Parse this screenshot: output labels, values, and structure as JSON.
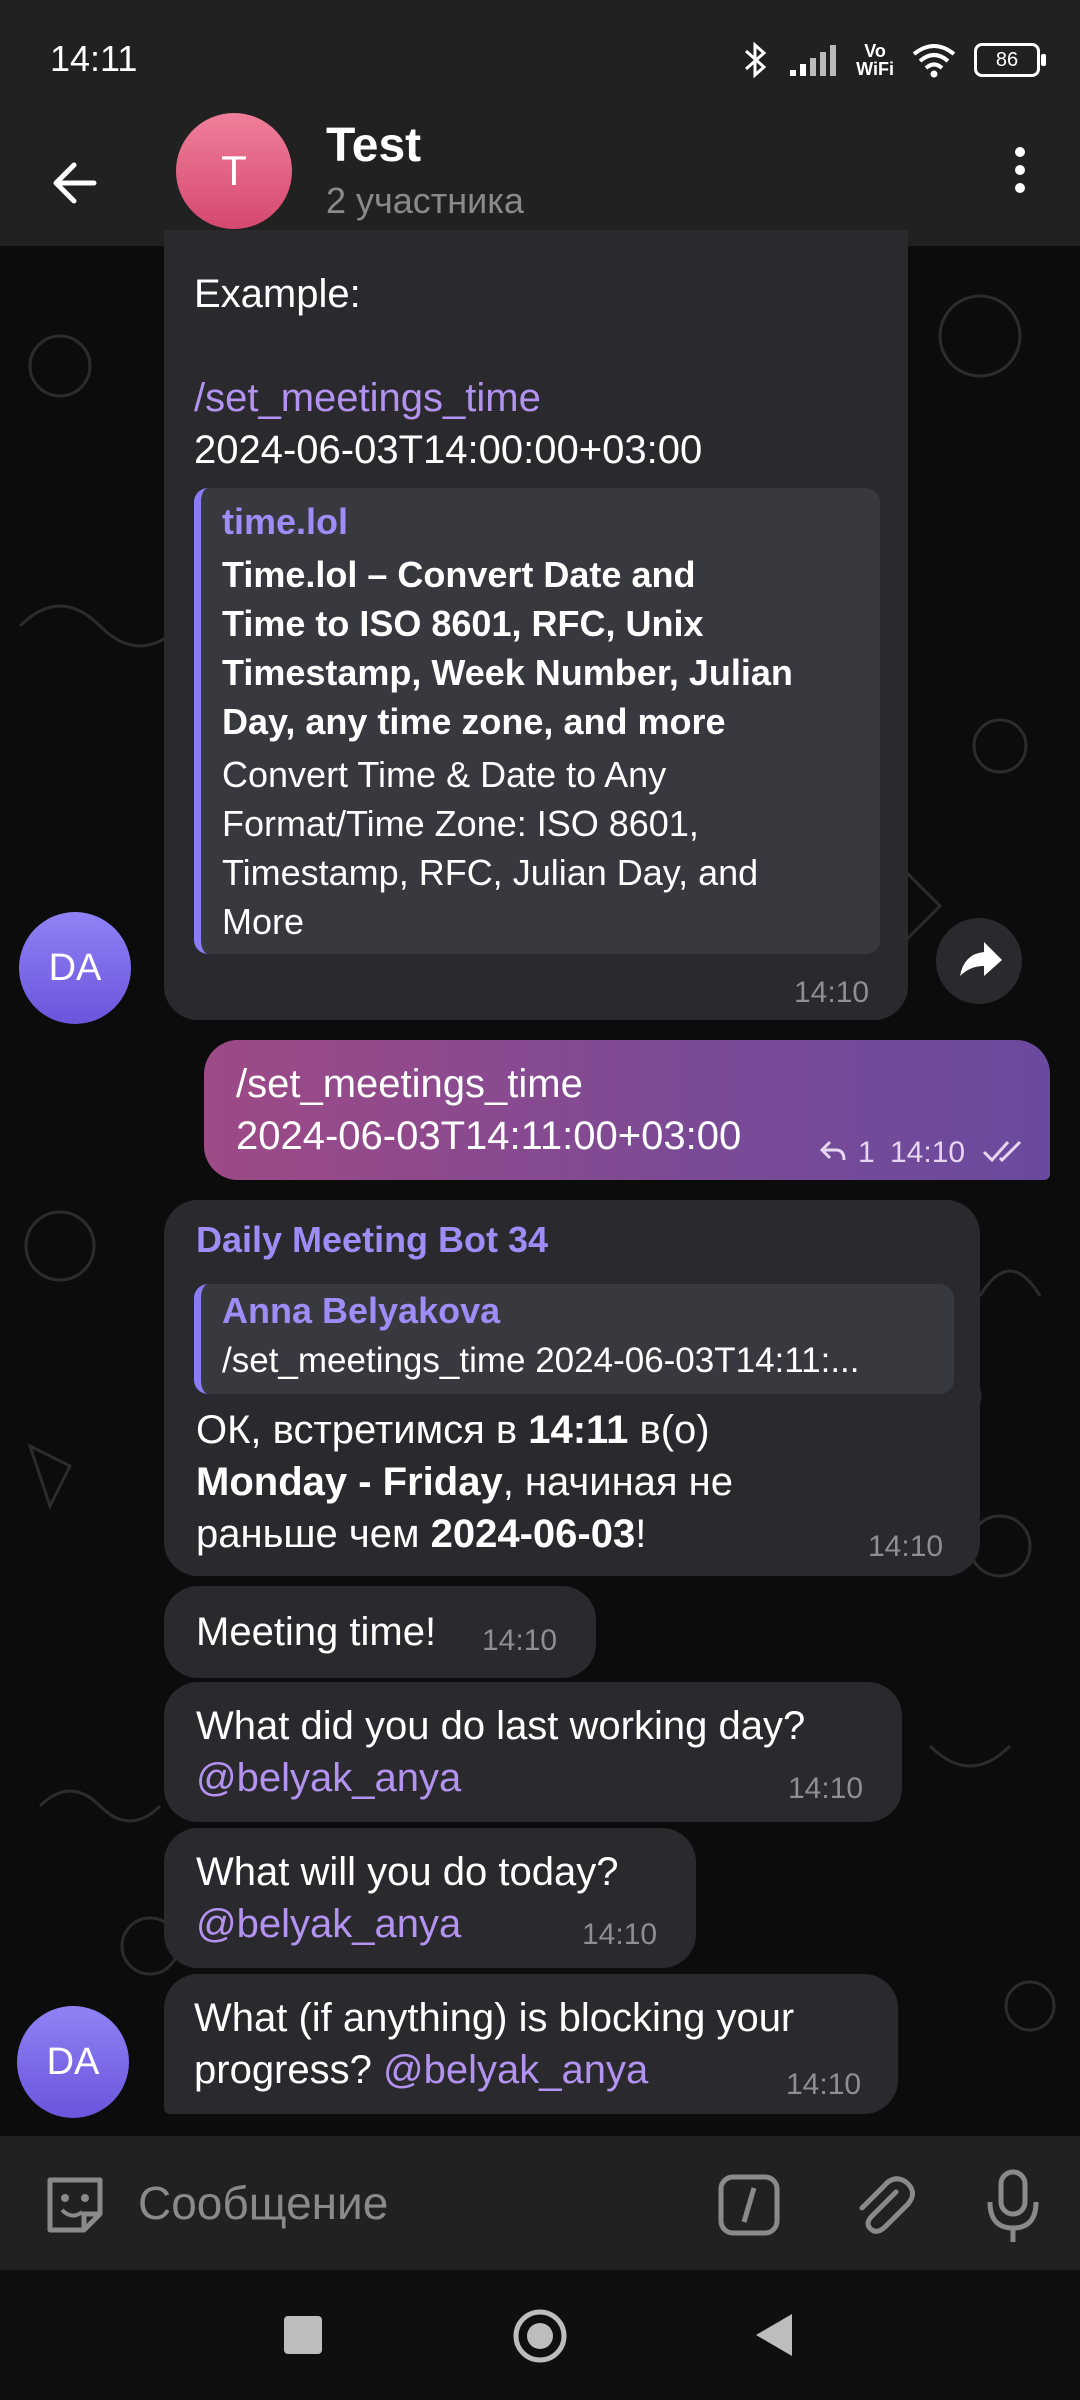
{
  "status": {
    "time": "14:11",
    "vowifi_top": "Vo",
    "vowifi_bottom": "WiFi",
    "battery": "86"
  },
  "header": {
    "avatar_letter": "T",
    "title": "Test",
    "subtitle": "2 участника"
  },
  "messages": {
    "m1": {
      "example_label": "Example:",
      "command": "/set_meetings_time",
      "datetime": "2024-06-03T14:00:00+03:00",
      "preview_site": "time.lol",
      "preview_title_1": "Time.lol – Convert Date and",
      "preview_title_2": "Time to ISO 8601, RFC, Unix",
      "preview_title_3": "Timestamp, Week Number, Julian",
      "preview_title_4": "Day, any time zone, and more",
      "preview_desc_1": "Convert Time & Date to Any",
      "preview_desc_2": "Format/Time Zone: ISO 8601,",
      "preview_desc_3": "Timestamp, RFC, Julian Day, and",
      "preview_desc_4": "More",
      "time": "14:10",
      "sender_avatar": "DA"
    },
    "m2": {
      "line1": "/set_meetings_time",
      "line2": "2024-06-03T14:11:00+03:00",
      "replies": "1",
      "time": "14:10"
    },
    "m3": {
      "sender": "Daily Meeting Bot 34",
      "quote_author": "Anna Belyakova",
      "quote_text": "/set_meetings_time 2024-06-03T14:11:...",
      "l1_a": "ОК, встретимся в ",
      "l1_b": "14:11",
      "l1_c": " в(о)",
      "l2_a": "Monday - Friday",
      "l2_b": ", начиная не",
      "l3_a": "раньше чем ",
      "l3_b": "2024-06-03",
      "l3_c": "!",
      "time": "14:10"
    },
    "m4": {
      "text": "Meeting time!",
      "time": "14:10"
    },
    "m5": {
      "text": "What did you do last working day?",
      "mention": "@belyak_anya",
      "time": "14:10"
    },
    "m6": {
      "text": "What will you do today?",
      "mention": "@belyak_anya",
      "time": "14:10"
    },
    "m7": {
      "text1": "What (if anything) is blocking your",
      "text2": "progress? ",
      "mention": "@belyak_anya",
      "time": "14:10",
      "sender_avatar": "DA"
    }
  },
  "composer": {
    "placeholder": "Сообщение"
  },
  "colors": {
    "accent": "#b392f0",
    "bubble": "#2a2a2e",
    "outgoing_start": "#9e4a86",
    "outgoing_end": "#6a4a9e"
  }
}
